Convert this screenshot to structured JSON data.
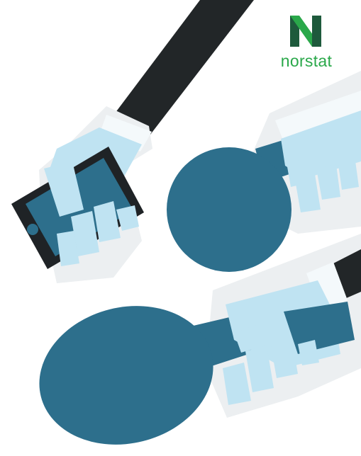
{
  "brand": {
    "wordmark": "norstat",
    "icon": "norstat-n-logo",
    "color_primary": "#2aa84a",
    "color_dark": "#1e5a3c"
  },
  "illustration": {
    "icons": [
      "smartphone-in-hand-icon",
      "microphone-in-hand-icon",
      "microphone-in-hand-icon"
    ],
    "colors": {
      "microphone": "#2d6f8c",
      "hand": "#bfe3f2",
      "sleeve": "#222628",
      "cuff": "#eef6f9",
      "outline": "#e6eaec"
    }
  }
}
